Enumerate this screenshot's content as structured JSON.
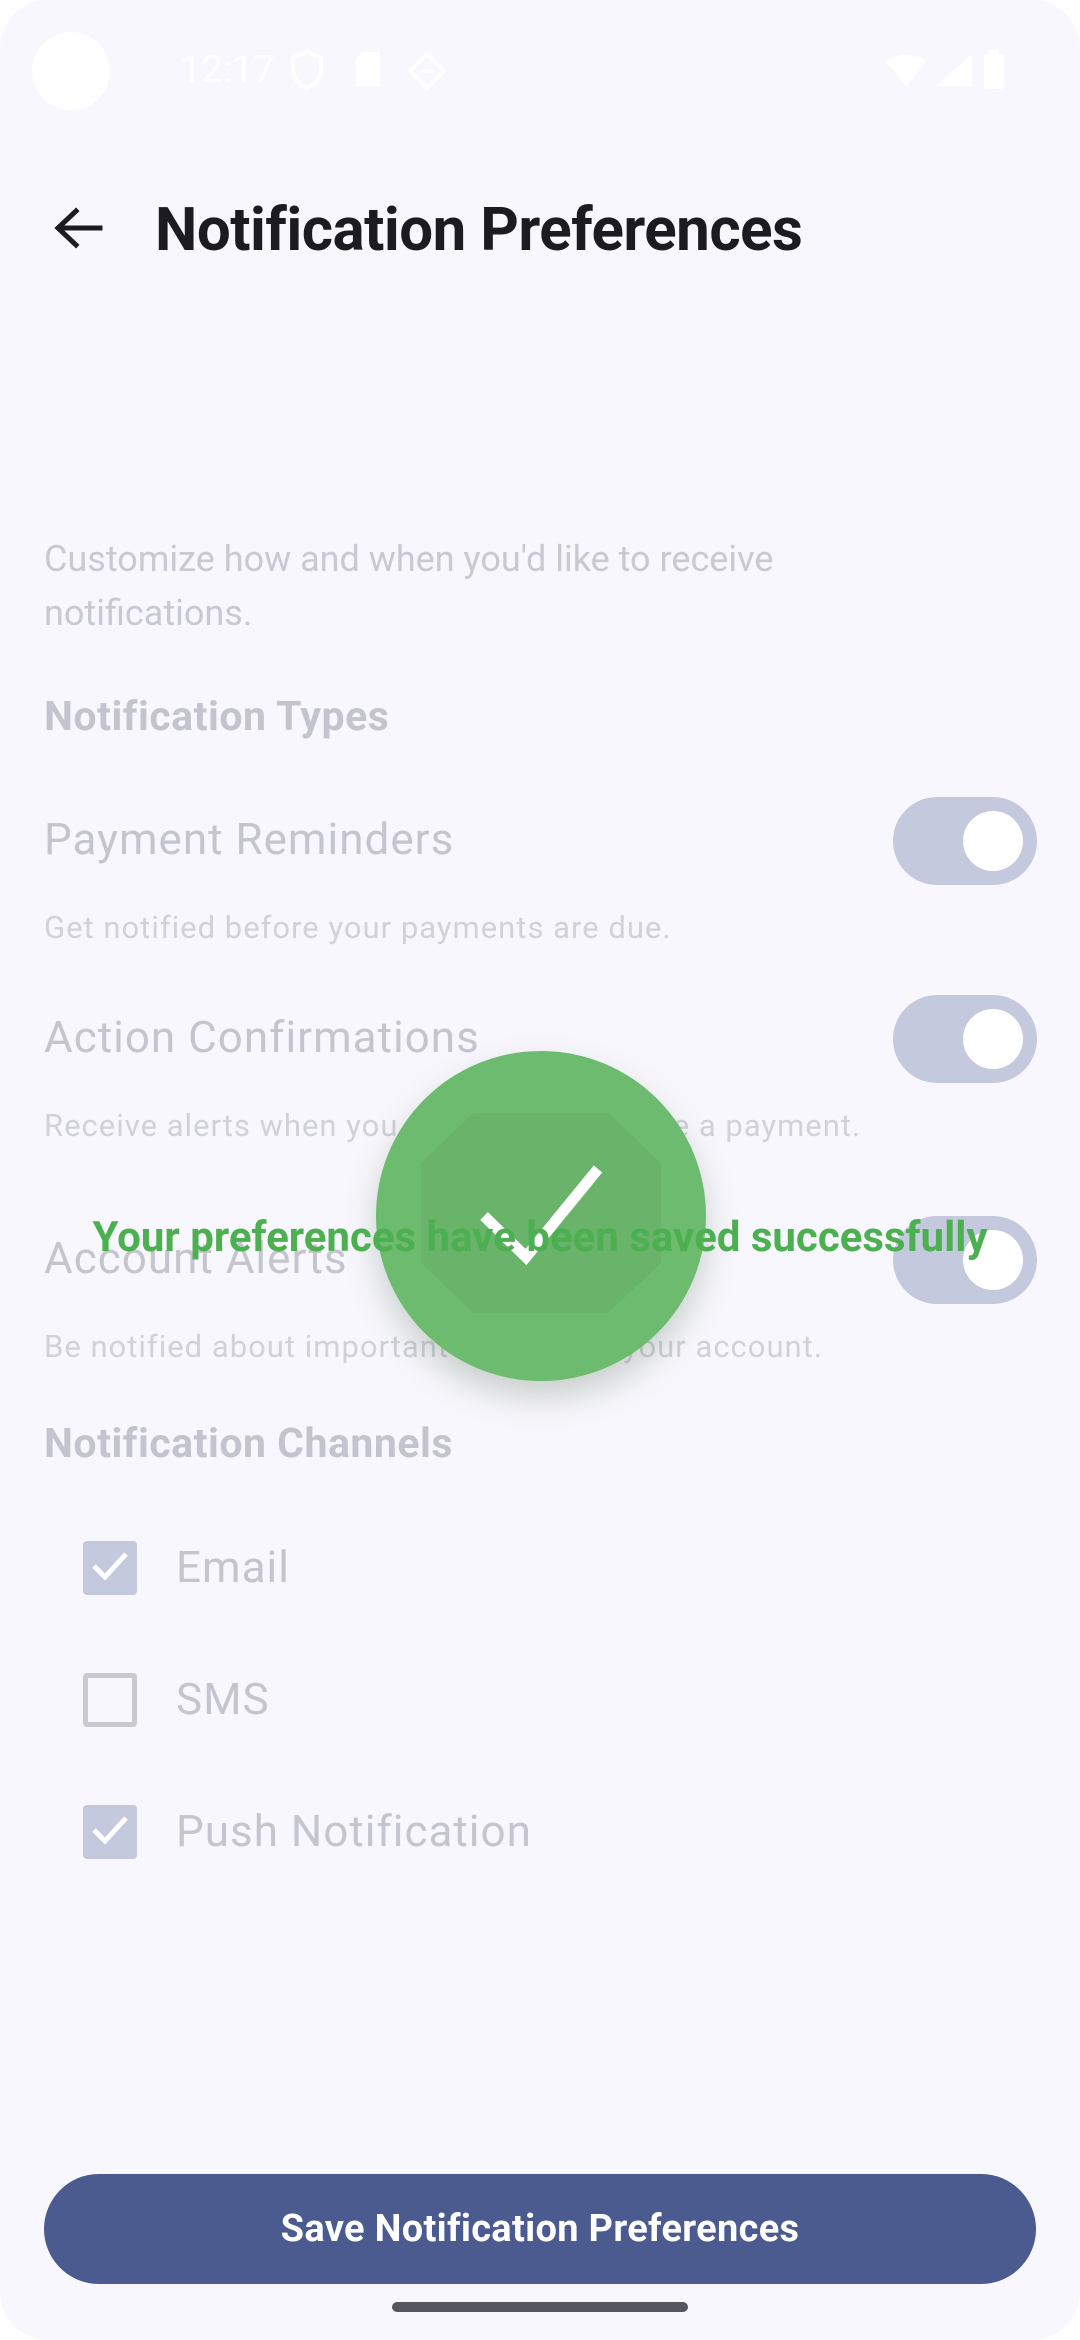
{
  "status_bar": {
    "time": "12:17"
  },
  "app_bar": {
    "title": "Notification Preferences",
    "back_icon": "arrow-back-icon"
  },
  "intro": "Customize how and when you'd like to receive notifications.",
  "sections": {
    "types_title": "Notification Types",
    "channels_title": "Notification Channels"
  },
  "notification_types": [
    {
      "title": "Payment Reminders",
      "description": "Get notified before your payments are due.",
      "enabled": true
    },
    {
      "title": "Action Confirmations",
      "description": "Receive alerts when you add a debt or make a payment.",
      "enabled": true
    },
    {
      "title": "Account Alerts",
      "description": "Be notified about important updates to your account.",
      "enabled": true
    }
  ],
  "channels": [
    {
      "label": "Email",
      "checked": true
    },
    {
      "label": "SMS",
      "checked": false
    },
    {
      "label": "Push Notification",
      "checked": true
    }
  ],
  "overlay": {
    "message": "Your preferences have been saved successfully",
    "icon": "checkmark-icon",
    "color": "#4caf50"
  },
  "save_button": {
    "label": "Save Notification Preferences",
    "color": "#4b5a8f"
  }
}
